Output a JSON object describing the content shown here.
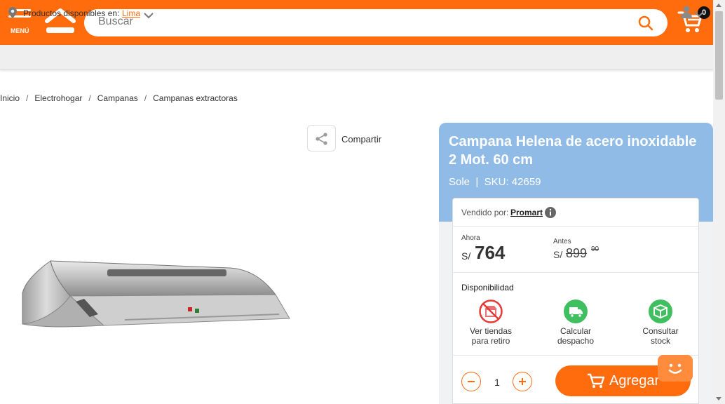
{
  "header": {
    "menu_label": "MENÚ",
    "search_placeholder": "Buscar",
    "cart_count": "0"
  },
  "location_bar": {
    "label": "Productos disponibles en:",
    "city": "Lima"
  },
  "breadcrumb": [
    "Inicio",
    "Electrohogar",
    "Campanas",
    "Campanas extractoras"
  ],
  "share": {
    "label": "Compartir"
  },
  "product": {
    "title": "Campana Helena de acero inoxidable 2 Mot. 60 cm",
    "brand": "Sole",
    "sku_label": "SKU: 42659",
    "sold_by_label": "Vendido por:",
    "seller": "Promart",
    "price_now_label": "Ahora",
    "price_currency": "S/",
    "price_now": "764",
    "price_before_label": "Antes",
    "price_before": "899",
    "price_before_cents": "90",
    "availability_label": "Disponibilidad",
    "availability": [
      {
        "label_line1": "Ver tiendas",
        "label_line2": "para retiro",
        "icon": "store-unavailable-icon",
        "color": "#e53935"
      },
      {
        "label_line1": "Calcular",
        "label_line2": "despacho",
        "icon": "truck-icon",
        "color": "#3fbf5f"
      },
      {
        "label_line1": "Consultar",
        "label_line2": "stock",
        "icon": "box-icon",
        "color": "#3fbf5f"
      }
    ],
    "quantity": "1",
    "add_label": "Agregar"
  },
  "colors": {
    "brand_orange": "#ff6c0e",
    "panel_blue": "#8fbbe6",
    "status_green": "#3fbf5f",
    "status_red": "#e53935"
  }
}
